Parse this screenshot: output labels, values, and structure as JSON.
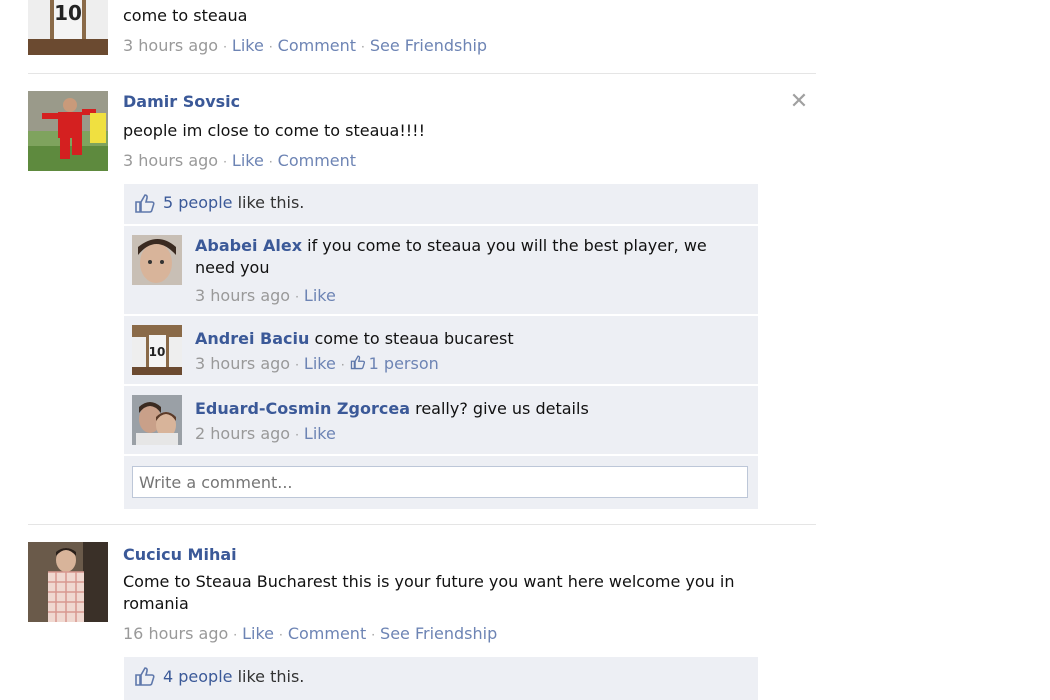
{
  "stories": [
    {
      "message": "come to steaua",
      "meta": {
        "time": "3 hours ago",
        "like": "Like",
        "comment": "Comment",
        "see_friendship": "See Friendship"
      }
    },
    {
      "author": "Damir Sovsic",
      "message": "people im close to come to steaua!!!!",
      "meta": {
        "time": "3 hours ago",
        "like": "Like",
        "comment": "Comment"
      },
      "likes": {
        "count_link": "5 people",
        "suffix": " like this."
      },
      "comments": [
        {
          "author": "Ababei Alex",
          "text": "if you come to steaua you will the best player, we",
          "text2": "need you",
          "time": "3 hours ago",
          "like": "Like"
        },
        {
          "author": "Andrei Baciu",
          "text": "come to steaua bucarest",
          "time": "3 hours ago",
          "like": "Like",
          "likes_count": "1 person"
        },
        {
          "author": "Eduard-Cosmin Zgorcea",
          "text": "really? give us details",
          "time": "2 hours ago",
          "like": "Like"
        }
      ],
      "comment_placeholder": "Write a comment..."
    },
    {
      "author": "Cucicu Mihai",
      "message": "Come to Steaua Bucharest this is your future you want here welcome you in",
      "message2": "romania",
      "meta": {
        "time": "16 hours ago",
        "like": "Like",
        "comment": "Comment",
        "see_friendship": "See Friendship"
      },
      "likes": {
        "count_link": "4 people",
        "suffix": " like this."
      }
    }
  ],
  "colors": {
    "link": "#3b5998",
    "muted": "#999999",
    "ufi_bg": "#edeff4"
  }
}
